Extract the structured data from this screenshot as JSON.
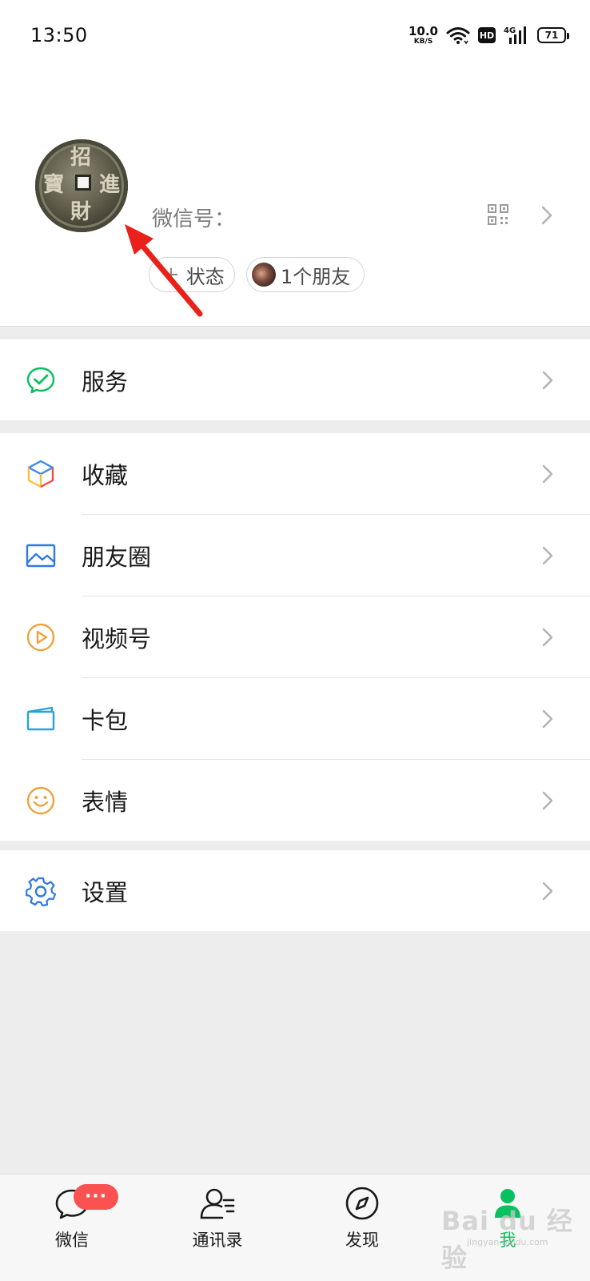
{
  "status_bar": {
    "time": "13:50",
    "net_speed_value": "10.0",
    "net_speed_unit": "KB/S",
    "hd": "HD",
    "cellular": "4G",
    "battery": "71"
  },
  "profile": {
    "avatar_text": [
      "招",
      "進",
      "財",
      "寶"
    ],
    "wechat_id_label": "微信号：",
    "status_pill": "状态",
    "friends_pill": "1个朋友"
  },
  "menu": {
    "services": "服务",
    "favorites": "收藏",
    "moments": "朋友圈",
    "channels": "视频号",
    "card_wallet": "卡包",
    "stickers": "表情",
    "settings": "设置"
  },
  "tab_bar": {
    "chats": "微信",
    "contacts": "通讯录",
    "discover": "发现",
    "me": "我",
    "chats_badge": "···"
  },
  "watermark": {
    "brand": "Bai du 经验",
    "url": "jingyan.baidu.com"
  },
  "colors": {
    "accent_green": "#07c160",
    "badge_red": "#fa5151",
    "annotation_arrow": "#e8221b"
  }
}
